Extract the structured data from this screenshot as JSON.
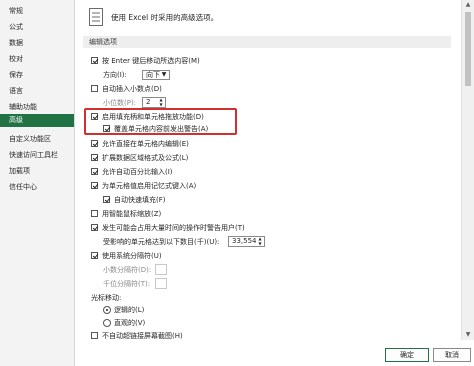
{
  "sidebar": {
    "items": [
      {
        "label": "常规"
      },
      {
        "label": "公式"
      },
      {
        "label": "数据"
      },
      {
        "label": "校对"
      },
      {
        "label": "保存"
      },
      {
        "label": "语言"
      },
      {
        "label": "辅助功能"
      },
      {
        "label": "高级",
        "selected": true
      },
      {
        "label": "自定义功能区"
      },
      {
        "label": "快速访问工具栏"
      },
      {
        "label": "加载项"
      },
      {
        "label": "信任中心"
      }
    ]
  },
  "header": {
    "text": "使用 Excel 时采用的高级选项。",
    "icon": "options-list-icon"
  },
  "section_title": "编辑选项",
  "options": {
    "move_after_enter": {
      "label": "按 Enter 键后移动所选内容(M)",
      "checked": true
    },
    "direction": {
      "label": "方向(I):",
      "value": "向下"
    },
    "auto_decimal": {
      "label": "自动插入小数点(D)",
      "checked": false
    },
    "decimal_places": {
      "label": "小位数(P):",
      "value": "2"
    },
    "fill_handle": {
      "label": "启用填充柄和单元格拖放功能(D)",
      "checked": true
    },
    "overwrite_alert": {
      "label": "覆盖单元格内容前发出警告(A)",
      "checked": true
    },
    "edit_in_cell": {
      "label": "允许直接在单元格内编辑(E)",
      "checked": true
    },
    "extend_formats": {
      "label": "扩展数据区域格式及公式(L)",
      "checked": true
    },
    "auto_percent": {
      "label": "允许自动百分比输入(I)",
      "checked": true
    },
    "autocomplete": {
      "label": "为单元格值启用记忆式键入(A)",
      "checked": true
    },
    "flash_fill": {
      "label": "自动快速填充(F)",
      "checked": true
    },
    "zoom_roll": {
      "label": "用智能鼠标缩放(Z)",
      "checked": false
    },
    "slow_op_alert": {
      "label": "发生可能会占用大量时间的操作时警告用户(T)",
      "checked": true
    },
    "cells_thousands": {
      "label": "受影响的单元格达到以下数目(千)(U):",
      "value": "33,554"
    },
    "system_separators": {
      "label": "使用系统分隔符(U)",
      "checked": true
    },
    "decimal_sep": {
      "label": "小数分隔符(D):",
      "value": "."
    },
    "thousands_sep": {
      "label": "千位分隔符(T):",
      "value": ","
    },
    "cursor_movement": {
      "label": "光标移动:"
    },
    "logical": {
      "label": "逻辑的(L)",
      "selected": true
    },
    "visual": {
      "label": "直观的(V)",
      "selected": false
    },
    "no_hyperlink_screenshot": {
      "label": "不自动超链接屏幕截图(H)",
      "checked": false
    }
  },
  "buttons": {
    "ok": "确定",
    "cancel": "取消"
  },
  "colors": {
    "accent": "#217346",
    "highlight": "#d03030"
  }
}
